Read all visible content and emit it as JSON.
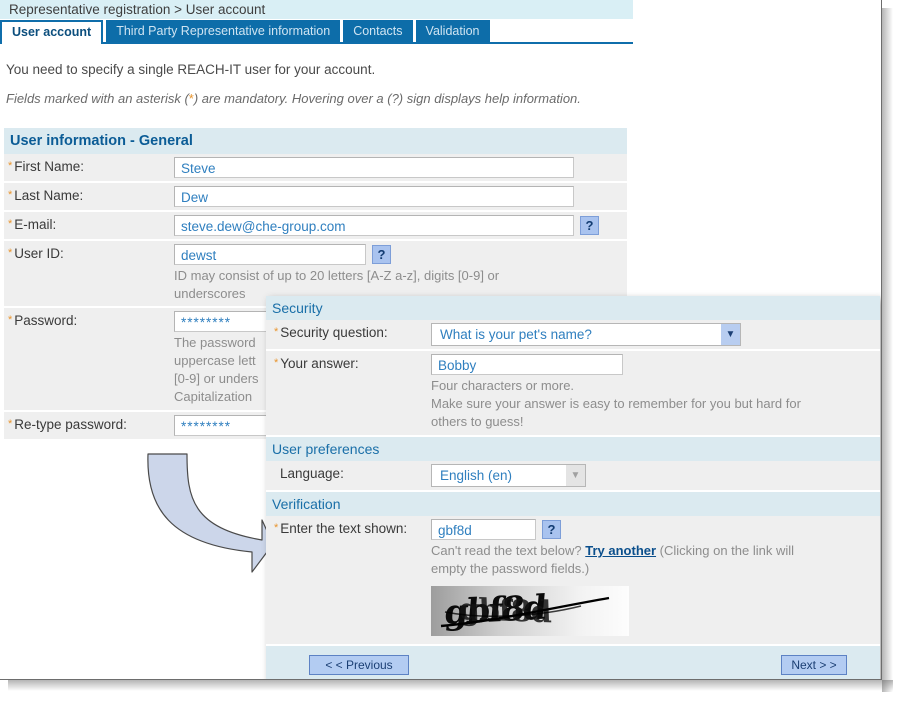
{
  "breadcrumb": {
    "text": "Representative registration > User account"
  },
  "tabs": [
    {
      "label": "User account",
      "active": true
    },
    {
      "label": "Third Party Representative information",
      "active": false
    },
    {
      "label": "Contacts",
      "active": false
    },
    {
      "label": "Validation",
      "active": false
    }
  ],
  "intro": {
    "line1": "You need to specify a single REACH-IT user for your account.",
    "line2_a": "Fields marked with an asterisk (",
    "line2_ast": "*",
    "line2_b": ") are mandatory. Hovering over a (?) sign displays help information."
  },
  "main_section": {
    "heading": "User information - General",
    "fields": {
      "first_name": {
        "label": "First Name:",
        "value": "Steve",
        "required": true
      },
      "last_name": {
        "label": "Last Name:",
        "value": "Dew",
        "required": true
      },
      "email": {
        "label": "E-mail:",
        "value": "steve.dew@che-group.com",
        "required": true,
        "help": "?"
      },
      "user_id": {
        "label": "User ID:",
        "value": "dewst",
        "required": true,
        "help": "?",
        "hint_line1": "ID may consist of up to 20 letters [A-Z a-z], digits [0-9] or",
        "hint_line2": "underscores"
      },
      "password": {
        "label": "Password:",
        "value": "********",
        "required": true,
        "hint_line1": "The password",
        "hint_line2": "uppercase lett",
        "hint_line3": "[0-9] or unders",
        "hint_line4": "Capitalization"
      },
      "retype_password": {
        "label": "Re-type password:",
        "value": "********",
        "required": true
      }
    }
  },
  "overlay": {
    "security": {
      "heading": "Security",
      "question": {
        "label": "Security question:",
        "selected": "What is your pet's name?",
        "required": true
      },
      "answer": {
        "label": "Your answer:",
        "value": "Bobby",
        "required": true,
        "hint_line1": "Four characters or more.",
        "hint_line2": "Make sure your answer is easy to remember for you but hard for",
        "hint_line3": "others to guess!"
      }
    },
    "preferences": {
      "heading": "User preferences",
      "language": {
        "label": "Language:",
        "selected": "English (en)",
        "required": false
      }
    },
    "verification": {
      "heading": "Verification",
      "captcha_field": {
        "label": "Enter the text shown:",
        "value": "gbf8d",
        "required": true,
        "help": "?"
      },
      "hint_prefix": "Can't read the text below? ",
      "hint_link": "Try another",
      "hint_suffix": " (Clicking on the link will",
      "hint_line2": "empty the password fields.)",
      "captcha_text": "gbf8d"
    },
    "buttons": {
      "previous": "< < Previous",
      "next": "Next > >"
    }
  },
  "colors": {
    "tab_active_text": "#0b4e7d",
    "tab_inactive_bg": "#0d6da9",
    "breadcrumb_bg": "#d9eff5",
    "section_header_bg": "#dbeaf0",
    "section_header_text": "#0b5c96",
    "input_text": "#2f7fbf",
    "asterisk": "#e8942d",
    "help_button_bg": "#a9c3ef",
    "nav_button_bg": "#b3ccf2",
    "arrow_fill": "#ccd6ea",
    "hint_text": "#8d8d8d"
  }
}
